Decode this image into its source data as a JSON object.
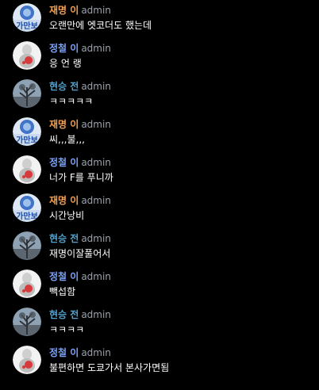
{
  "colors": {
    "background": "#000000",
    "text": "#ffffff",
    "role": "#9aa3ad",
    "user_orange": "#f0a050",
    "user_blue": "#7aa2f7",
    "user_teal": "#4fa3d1"
  },
  "messages": [
    {
      "user": "재명 이",
      "role": "admin",
      "text": "오랜만에 엣코더도 했는데",
      "avatar_icon": "badge-logo-avatar-icon",
      "name_color": "#f0a050"
    },
    {
      "user": "정철 이",
      "role": "admin",
      "text": "응 언 랭",
      "avatar_icon": "figurine-avatar-icon",
      "name_color": "#7aa2f7"
    },
    {
      "user": "현승 전",
      "role": "admin",
      "text": "ㅋㅋㅋㅋㅋ",
      "avatar_icon": "tree-avatar-icon",
      "name_color": "#4fa3d1"
    },
    {
      "user": "재명 이",
      "role": "admin",
      "text": "씨,,,불,,,",
      "avatar_icon": "badge-logo-avatar-icon",
      "name_color": "#f0a050"
    },
    {
      "user": "정철 이",
      "role": "admin",
      "text": "너가 F를 푸니까",
      "avatar_icon": "figurine-avatar-icon",
      "name_color": "#7aa2f7"
    },
    {
      "user": "재명 이",
      "role": "admin",
      "text": "시간낭비",
      "avatar_icon": "badge-logo-avatar-icon",
      "name_color": "#f0a050"
    },
    {
      "user": "현승 전",
      "role": "admin",
      "text": "재명이잘풀어서",
      "avatar_icon": "tree-avatar-icon",
      "name_color": "#4fa3d1"
    },
    {
      "user": "정철 이",
      "role": "admin",
      "text": "빽섭함",
      "avatar_icon": "figurine-avatar-icon",
      "name_color": "#7aa2f7"
    },
    {
      "user": "현승 전",
      "role": "admin",
      "text": "ㅋㅋㅋㅋ",
      "avatar_icon": "tree-avatar-icon",
      "name_color": "#4fa3d1"
    },
    {
      "user": "정철 이",
      "role": "admin",
      "text": "불편하면 도쿄가서 본사가면됨",
      "avatar_icon": "figurine-avatar-icon",
      "name_color": "#7aa2f7"
    }
  ]
}
